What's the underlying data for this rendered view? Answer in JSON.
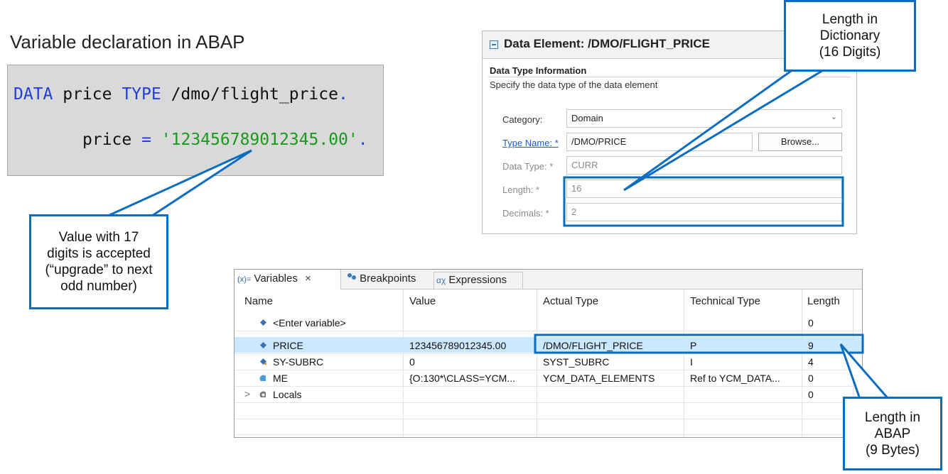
{
  "slide": {
    "heading": "Variable declaration in ABAP"
  },
  "code": {
    "line1": {
      "kw1": "DATA",
      "name": " price ",
      "kw2": "TYPE",
      "type": " /dmo/flight_price",
      "dot": "."
    },
    "line2": {
      "name": "price",
      "eq": " = ",
      "str": "'123456789012345.00'",
      "dot": "."
    }
  },
  "callouts": {
    "value17": [
      "Value with 17",
      "digits is accepted",
      "(“upgrade” to next",
      "odd number)"
    ],
    "dictionary": [
      "Length in",
      "Dictionary",
      "(16 Digits)"
    ],
    "abap": [
      "Length in",
      "ABAP",
      "(9 Bytes)"
    ]
  },
  "data_element": {
    "title": "Data Element: /DMO/FLIGHT_PRICE",
    "section": "Data Type Information",
    "description": "Specify the data type of the data element",
    "category_label": "Category:",
    "category_value": "Domain",
    "type_name_label": "Type Name: *",
    "type_name_value": "/DMO/PRICE",
    "browse_label": "Browse...",
    "data_type_label": "Data Type: *",
    "data_type_value": "CURR",
    "length_label": "Length: *",
    "length_value": "16",
    "decimals_label": "Decimals: *",
    "decimals_value": "2"
  },
  "variables_view": {
    "tabs": [
      {
        "label": "Variables",
        "icon": "variables-icon",
        "close": "×"
      },
      {
        "label": "Breakpoints",
        "icon": "breakpoints-icon"
      },
      {
        "label": "Expressions",
        "icon": "expressions-icon"
      }
    ],
    "tab_prefix": "(x)=",
    "columns": [
      "Name",
      "Value",
      "Actual Type",
      "Technical Type",
      "Length"
    ],
    "rows": [
      {
        "name": "<Enter variable>",
        "value": "",
        "actual_type": "",
        "technical_type": "",
        "length": "0",
        "icon": "variable-diamond-icon"
      },
      {
        "name": "PRICE",
        "value": "123456789012345.00",
        "actual_type": "/DMO/FLIGHT_PRICE",
        "technical_type": "P",
        "length": "9",
        "icon": "variable-diamond-icon",
        "selected": true
      },
      {
        "name": "SY-SUBRC",
        "value": "0",
        "actual_type": "SYST_SUBRC",
        "technical_type": "I",
        "length": "4",
        "icon": "system-variable-icon"
      },
      {
        "name": "ME",
        "value": "{O:130*\\CLASS=YCM...",
        "actual_type": "YCM_DATA_ELEMENTS",
        "technical_type": "Ref to YCM_DATA...",
        "length": "0",
        "icon": "object-ref-icon"
      },
      {
        "name": "Locals",
        "value": "",
        "actual_type": "",
        "technical_type": "",
        "length": "0",
        "icon": "locals-icon",
        "expander": ">"
      }
    ]
  },
  "colors": {
    "callout_border": "#0b6dbf",
    "selection": "#cce8ff",
    "keyword": "#1f3fd8",
    "string": "#1a9a1a"
  }
}
